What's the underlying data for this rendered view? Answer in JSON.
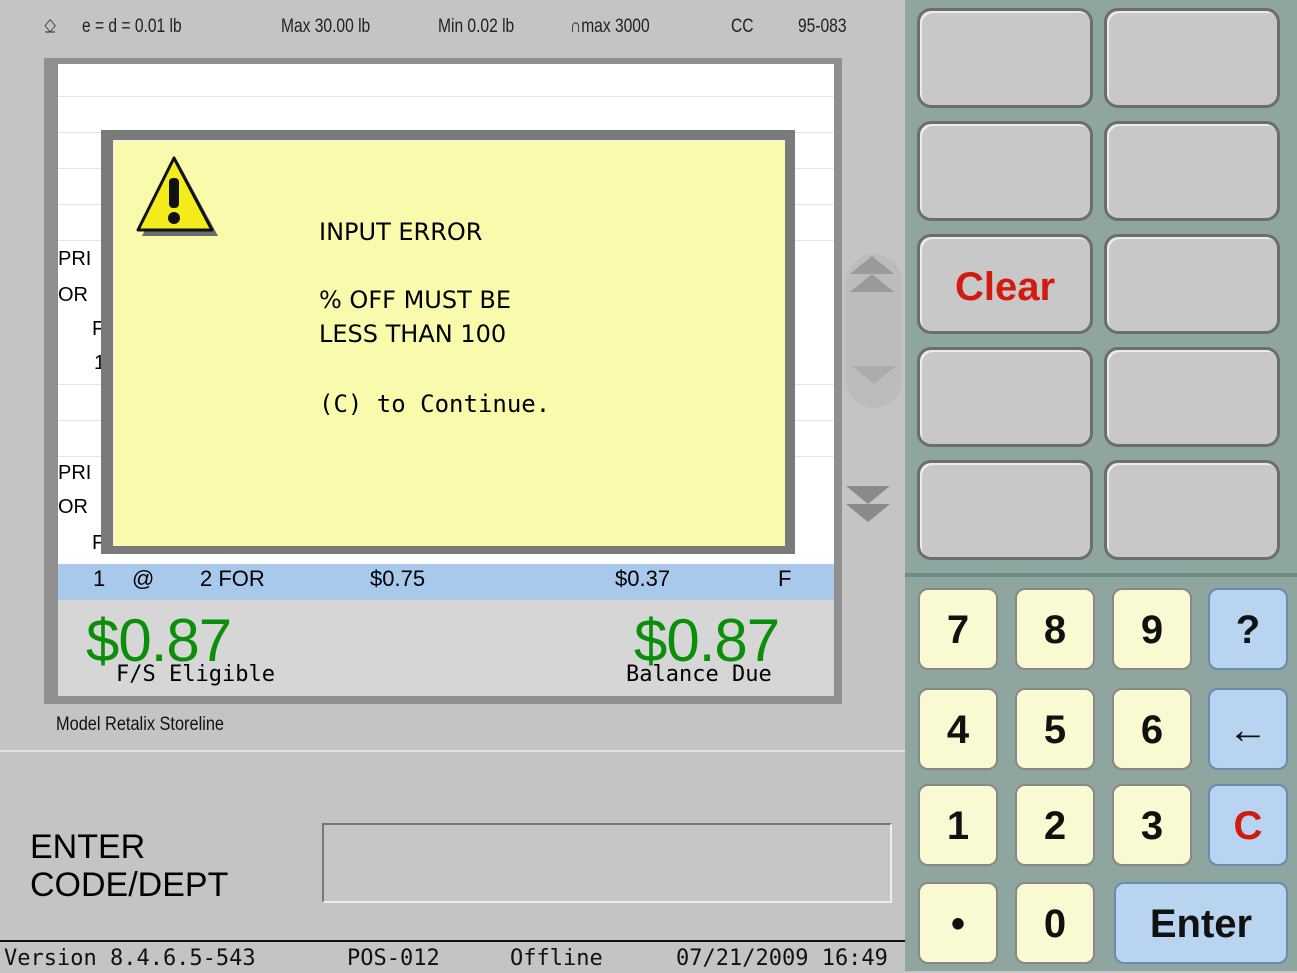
{
  "header": {
    "scale_symbol": "⎐",
    "division": "e = d = 0.01 lb",
    "max": "Max 30.00 lb",
    "min": "Min 0.02 lb",
    "nmax": "∩max 3000",
    "cc": "CC",
    "cert": "95-083"
  },
  "receipt": {
    "partial_lines": [
      "PRI",
      "OR",
      "F",
      "1",
      "PRI",
      "OR",
      "F"
    ],
    "selected_row": {
      "qty": "1",
      "at": "@",
      "deal": "2 FOR",
      "price": "$0.75",
      "amount": "$0.37",
      "flag": "F"
    },
    "fs_eligible_amount": "$0.87",
    "fs_eligible_label": "F/S Eligible",
    "balance_due_amount": "$0.87",
    "balance_due_label": "Balance Due"
  },
  "dialog": {
    "title": "INPUT ERROR",
    "message_line1": "% OFF MUST BE",
    "message_line2": "LESS THAN 100",
    "hint": "(C) to Continue.",
    "icon": "warning-icon"
  },
  "footer": {
    "model": "Model Retalix Storeline",
    "prompt_line1": "ENTER",
    "prompt_line2": "CODE/DEPT",
    "input_value": "",
    "version": "Version  8.4.6.5-543",
    "pos": "POS-012",
    "mode": "Offline",
    "datetime": "07/21/2009 16:49"
  },
  "function_keys": {
    "clear": "Clear"
  },
  "keypad": {
    "k7": "7",
    "k8": "8",
    "k9": "9",
    "help": "?",
    "k4": "4",
    "k5": "5",
    "k6": "6",
    "back": "←",
    "k1": "1",
    "k2": "2",
    "k3": "3",
    "clear": "C",
    "dot": "•",
    "k0": "0",
    "enter": "Enter"
  },
  "colors": {
    "amount_green": "#0b8f0b",
    "clear_red": "#d21a0f",
    "dialog_yellow": "#fafaac",
    "selection_blue": "#a8c8ec",
    "panel_teal": "#8fa5a0"
  }
}
